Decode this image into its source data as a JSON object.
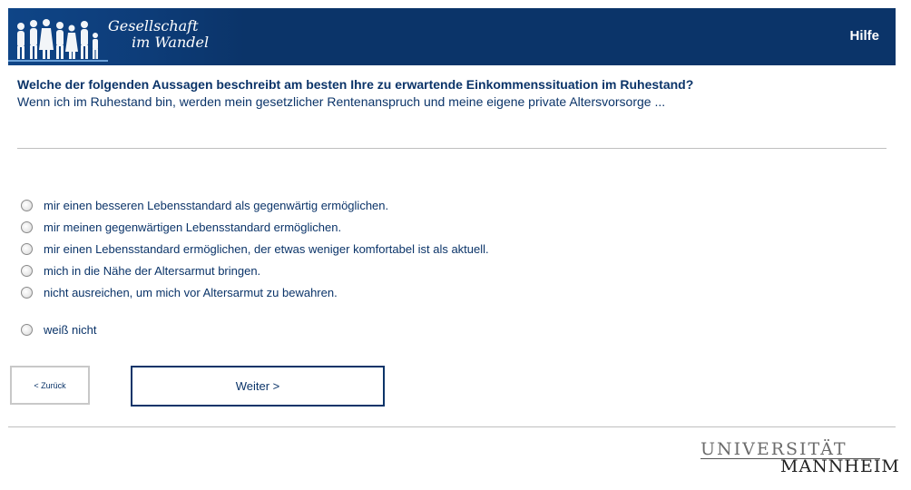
{
  "header": {
    "logo_line1": "Gesellschaft",
    "logo_line2": "im Wandel",
    "logo_icon": "people-silhouettes-icon",
    "help_label": "Hilfe"
  },
  "question": {
    "title": "Welche der folgenden Aussagen beschreibt am besten Ihre zu erwartende Einkommenssituation im Ruhestand?",
    "subtitle": "Wenn ich im Ruhestand bin, werden mein gesetzlicher Rentenanspruch und meine eigene private Altersvorsorge ..."
  },
  "options": [
    {
      "label": "mir einen besseren Lebensstandard als gegenwärtig ermöglichen.",
      "selected": false
    },
    {
      "label": "mir meinen gegenwärtigen Lebensstandard ermöglichen.",
      "selected": false
    },
    {
      "label": "mir einen Lebensstandard ermöglichen, der etwas weniger komfortabel ist als aktuell.",
      "selected": false
    },
    {
      "label": "mich in die Nähe der Altersarmut bringen.",
      "selected": false
    },
    {
      "label": "nicht ausreichen, um mich vor Altersarmut zu bewahren.",
      "selected": false
    },
    {
      "label": "weiß nicht",
      "selected": false
    }
  ],
  "navigation": {
    "back_label": "< Zurück",
    "next_label": "Weiter >"
  },
  "footer": {
    "university_line1": "UNIVERSITÄT",
    "university_line2": "MANNHEIM"
  },
  "colors": {
    "brand": "#0b3469",
    "text": "#0b3469",
    "rule": "#bfbfbf"
  }
}
